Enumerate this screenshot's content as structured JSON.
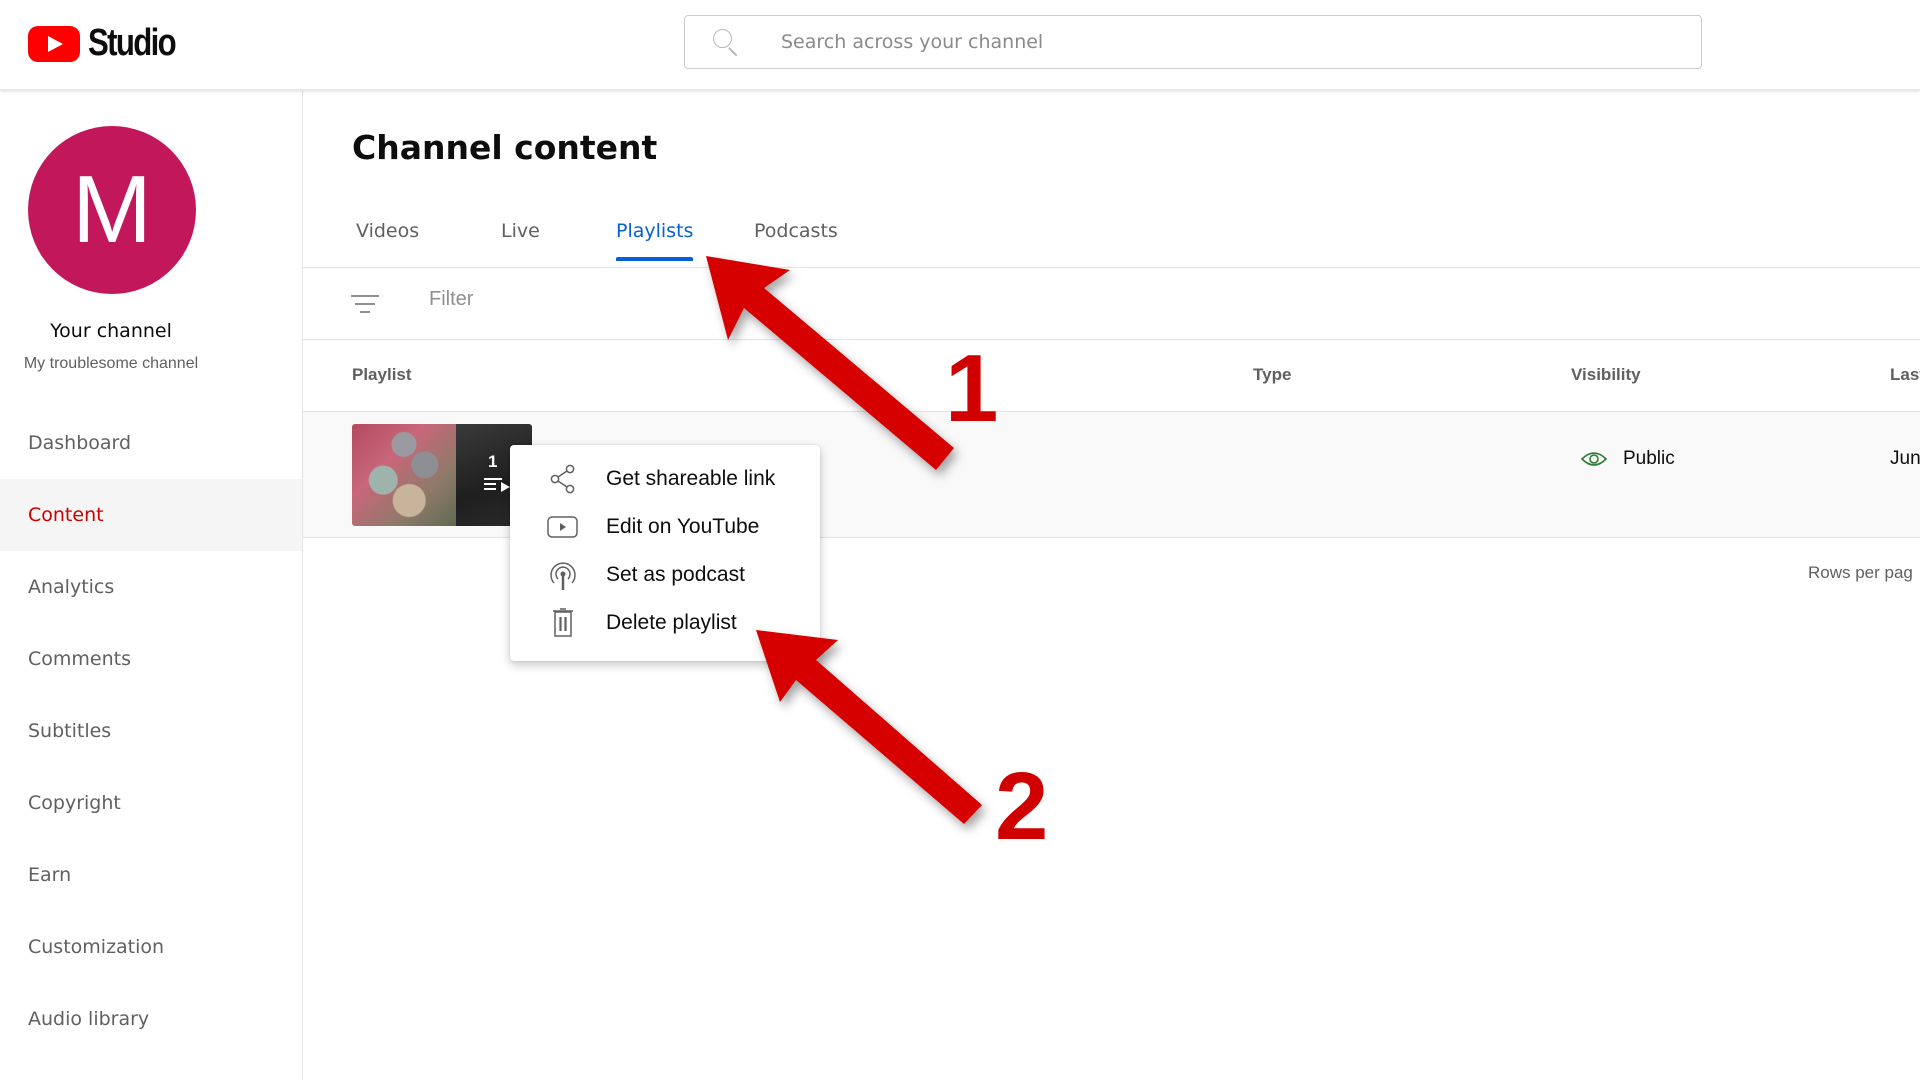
{
  "header": {
    "logo_text": "Studio",
    "search_placeholder": "Search across your channel"
  },
  "sidebar": {
    "avatar_letter": "M",
    "channel_label": "Your channel",
    "channel_name": "My troublesome channel",
    "items": [
      {
        "label": "Dashboard",
        "active": false
      },
      {
        "label": "Content",
        "active": true
      },
      {
        "label": "Analytics",
        "active": false
      },
      {
        "label": "Comments",
        "active": false
      },
      {
        "label": "Subtitles",
        "active": false
      },
      {
        "label": "Copyright",
        "active": false
      },
      {
        "label": "Earn",
        "active": false
      },
      {
        "label": "Customization",
        "active": false
      },
      {
        "label": "Audio library",
        "active": false
      }
    ]
  },
  "main": {
    "title": "Channel content",
    "tabs": [
      {
        "label": "Videos",
        "active": false
      },
      {
        "label": "Live",
        "active": false
      },
      {
        "label": "Playlists",
        "active": true
      },
      {
        "label": "Podcasts",
        "active": false
      }
    ],
    "filter_placeholder": "Filter",
    "columns": [
      "Playlist",
      "Type",
      "Visibility",
      "Last"
    ],
    "rows": [
      {
        "video_count": "1",
        "visibility": "Public",
        "last_updated": "Jun"
      }
    ],
    "rows_per_page_label": "Rows per pag"
  },
  "context_menu": {
    "items": [
      {
        "label": "Get shareable link",
        "icon": "share-icon"
      },
      {
        "label": "Edit on YouTube",
        "icon": "youtube-play-icon"
      },
      {
        "label": "Set as podcast",
        "icon": "podcast-icon"
      },
      {
        "label": "Delete playlist",
        "icon": "trash-icon"
      }
    ]
  },
  "annotations": {
    "step1": "1",
    "step2": "2"
  },
  "colors": {
    "brand_red": "#ff0000",
    "active_nav": "#cc0000",
    "active_tab": "#065fd4",
    "avatar_bg": "#c2185b",
    "public_green": "#2e7d32",
    "annotation_red": "#d00000"
  }
}
